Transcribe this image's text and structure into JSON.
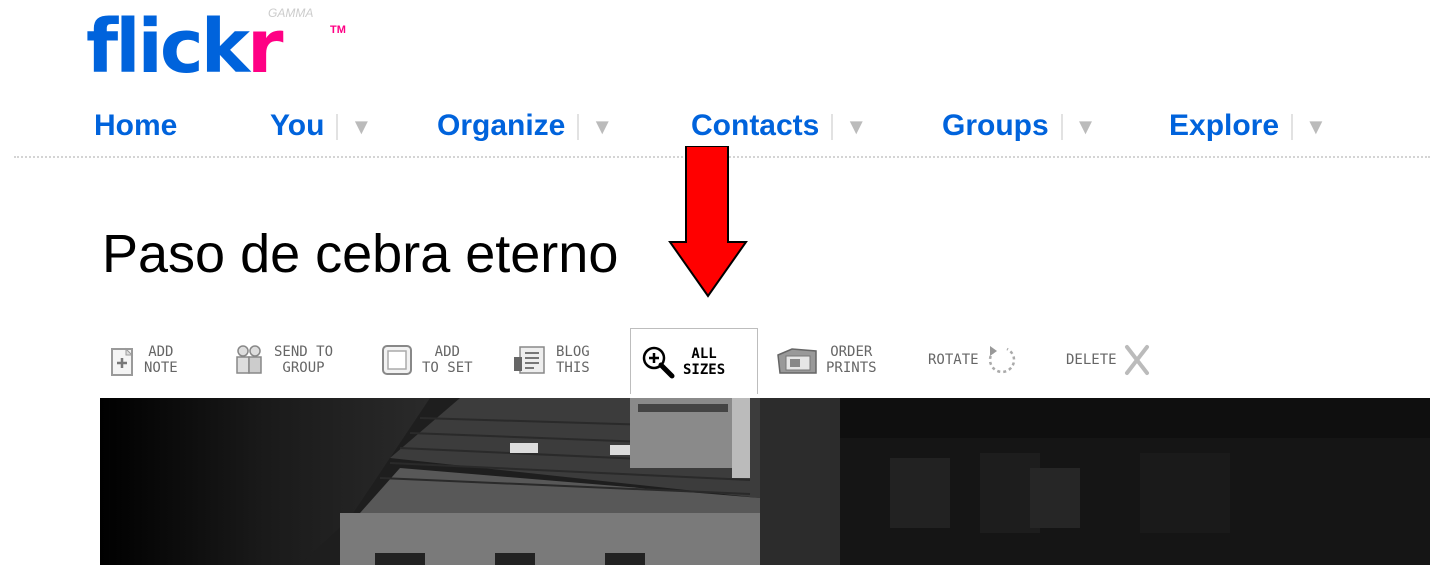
{
  "logo": {
    "brand_main": "flick",
    "brand_accent": "r",
    "tm": "TM",
    "badge": "GAMMA",
    "brand_blue": "#0063dc",
    "brand_pink": "#ff0084"
  },
  "nav": {
    "items": [
      {
        "label": "Home",
        "has_menu": false
      },
      {
        "label": "You",
        "has_menu": true
      },
      {
        "label": "Organize",
        "has_menu": true
      },
      {
        "label": "Contacts",
        "has_menu": true
      },
      {
        "label": "Groups",
        "has_menu": true
      },
      {
        "label": "Explore",
        "has_menu": true
      }
    ],
    "caret": "▼"
  },
  "photo": {
    "title": "Paso de cebra eterno"
  },
  "toolbar": {
    "items": [
      {
        "label": "ADD\nNOTE",
        "icon": "add-note-icon"
      },
      {
        "label": "SEND TO\nGROUP",
        "icon": "send-to-group-icon"
      },
      {
        "label": "ADD\nTO SET",
        "icon": "add-to-set-icon"
      },
      {
        "label": "BLOG\nTHIS",
        "icon": "blog-this-icon"
      },
      {
        "label": "ALL\nSIZES",
        "icon": "zoom-icon",
        "selected": true
      },
      {
        "label": "ORDER\nPRINTS",
        "icon": "order-prints-icon"
      },
      {
        "label": "ROTATE",
        "icon": "rotate-icon"
      },
      {
        "label": "DELETE",
        "icon": "delete-icon"
      }
    ]
  },
  "annotation": {
    "arrow_color": "#ff0000",
    "points_to": "ALL SIZES"
  }
}
